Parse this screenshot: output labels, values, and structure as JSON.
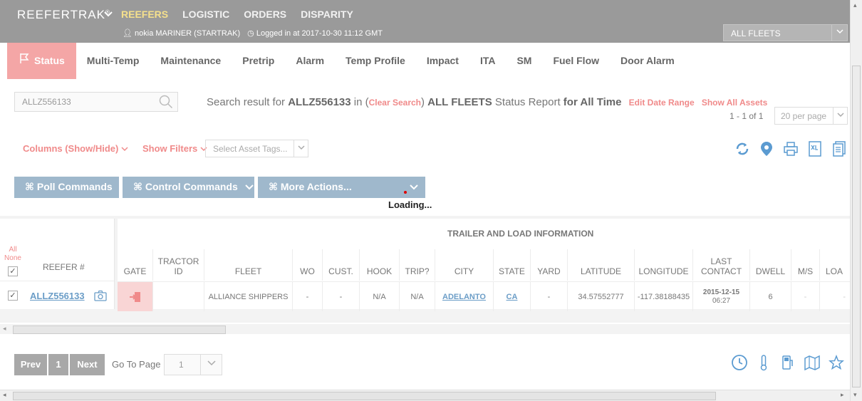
{
  "header": {
    "brand": "REEFERTRAK",
    "brand_mark": "®",
    "nav": [
      "REEFERS",
      "LOGISTIC",
      "ORDERS",
      "DISPARITY"
    ],
    "user": "nokia MARINER (STARTRAK)",
    "logged_in": "Logged in at 2017-10-30 11:12 GMT",
    "fleet_select": "ALL FLEETS"
  },
  "tabs": [
    "Status",
    "Multi-Temp",
    "Maintenance",
    "Pretrip",
    "Alarm",
    "Temp Profile",
    "Impact",
    "ITA",
    "SM",
    "Fuel Flow",
    "Door Alarm"
  ],
  "search": {
    "value": "ALLZ556133",
    "result_prefix": "Search result for",
    "result_term": "ALLZ556133",
    "in_text": "in (",
    "clear": "Clear Search",
    "close_paren": ")",
    "fleet": "ALL FLEETS",
    "report": "Status Report",
    "range": "for All Time",
    "edit_range": "Edit Date Range",
    "show_all": "Show All Assets",
    "count": "1 - 1 of 1",
    "per_page": "20 per page"
  },
  "filters": {
    "columns": "Columns (Show/Hide)",
    "show_filters": "Show Filters",
    "tags_placeholder": "Select Asset Tags..."
  },
  "actions": {
    "poll": "⌘ Poll Commands",
    "control": "⌘ Control Commands",
    "more": "⌘ More Actions...",
    "loading": "Loading..."
  },
  "table": {
    "group_title": "TRAILER AND LOAD INFORMATION",
    "all": "All",
    "none": "None",
    "reefer_header": "REEFER #",
    "columns": [
      "GATE",
      "TRACTOR ID",
      "FLEET",
      "WO",
      "CUST.",
      "HOOK",
      "TRIP?",
      "CITY",
      "STATE",
      "YARD",
      "LATITUDE",
      "LONGITUDE",
      "LAST CONTACT",
      "DWELL",
      "M/S",
      "LOA"
    ],
    "row": {
      "reefer": "ALLZ556133",
      "tractor": "",
      "fleet": "ALLIANCE SHIPPERS",
      "wo": "-",
      "cust": "-",
      "hook": "N/A",
      "trip": "N/A",
      "city": "ADELANTO",
      "state": "CA",
      "yard": "-",
      "latitude": "34.57552777",
      "longitude": "-117.38188435",
      "last_contact_date": "2015-12-15",
      "last_contact_time": "06:27",
      "dwell": "6",
      "ms": "-",
      "loa": "-"
    }
  },
  "pager": {
    "prev": "Prev",
    "page": "1",
    "next": "Next",
    "goto": "Go To Page",
    "goto_value": "1"
  },
  "colors": {
    "accent": "#f08a8a",
    "tab_active": "#f4a6a6",
    "topbar": "#9a9a9a",
    "action_btn": "#9fb8cc",
    "icon_blue": "#5b9bd1"
  }
}
